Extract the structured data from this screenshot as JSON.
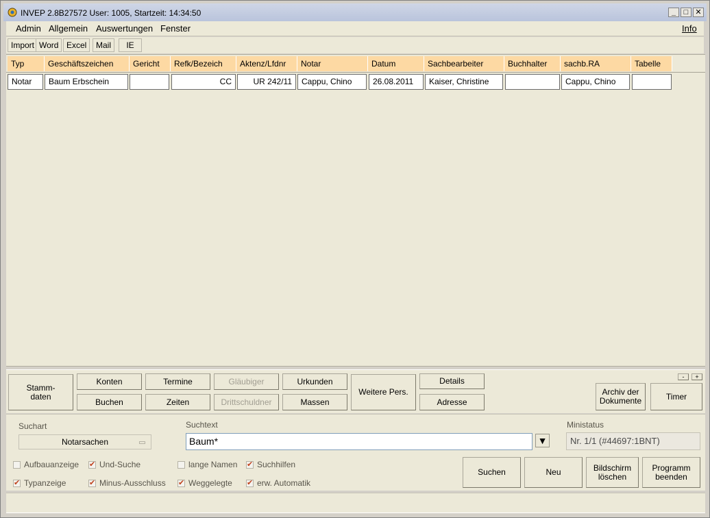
{
  "window": {
    "title": "INVEP 2.8B27572 User: 1005, Startzeit: 14:34:50",
    "min_glyph": "_",
    "max_glyph": "□",
    "close_glyph": "✕"
  },
  "menu": {
    "items": [
      "Admin",
      "Allgemein",
      "Auswertungen",
      "Fenster"
    ],
    "info": "Info"
  },
  "toolbar": {
    "items": [
      "Import",
      "Word",
      "Excel",
      "Mail",
      "IE"
    ]
  },
  "table": {
    "headers": [
      "Typ",
      "Geschäftszeichen",
      "Gericht",
      "Refk/Bezeich",
      "Aktenz/Lfdnr",
      "Notar",
      "Datum",
      "Sachbearbeiter",
      "Buchhalter",
      "sachb.RA",
      "Tabelle"
    ],
    "rows": [
      [
        "Notar",
        "Baum Erbschein",
        "",
        "CC",
        "UR 242/11",
        "Cappu, Chino",
        "26.08.2011",
        "Kaiser, Christine",
        "",
        "Cappu, Chino",
        ""
      ]
    ]
  },
  "buttons": {
    "stammdaten": "Stamm-\ndaten",
    "konten": "Konten",
    "buchen": "Buchen",
    "termine": "Termine",
    "zeiten": "Zeiten",
    "glaeubiger": "Gläubiger",
    "drittschuldner": "Drittschuldner",
    "urkunden": "Urkunden",
    "massen": "Massen",
    "weitere_pers": "Weitere Pers.",
    "details": "Details",
    "adresse": "Adresse",
    "minus": "-",
    "plus": "+",
    "archiv": "Archiv der\nDokumente",
    "timer": "Timer"
  },
  "search": {
    "suchart_label": "Suchart",
    "suchart_value": "Notarsachen",
    "suchtext_label": "Suchtext",
    "suchtext_value": "Baum*",
    "dropdown_glyph": "▼",
    "ministatus_label": "Ministatus",
    "ministatus_value": "Nr. 1/1 (#44697:1BNT)"
  },
  "checkboxes": [
    {
      "label": "Aufbauanzeige",
      "checked": false
    },
    {
      "label": "Und-Suche",
      "checked": true
    },
    {
      "label": "lange Namen",
      "checked": false
    },
    {
      "label": "Suchhilfen",
      "checked": true
    },
    {
      "label": "Typanzeige",
      "checked": true
    },
    {
      "label": "Minus-Ausschluss",
      "checked": true
    },
    {
      "label": "Weggelegte",
      "checked": true
    },
    {
      "label": "erw. Automatik",
      "checked": true
    }
  ],
  "actions": {
    "suchen": "Suchen",
    "neu": "Neu",
    "bildschirm": "Bildschirm\nlöschen",
    "programm": "Programm\nbeenden"
  },
  "colors": {
    "header_bg": "#fdd9a3",
    "check_mark": "#c0431f"
  }
}
